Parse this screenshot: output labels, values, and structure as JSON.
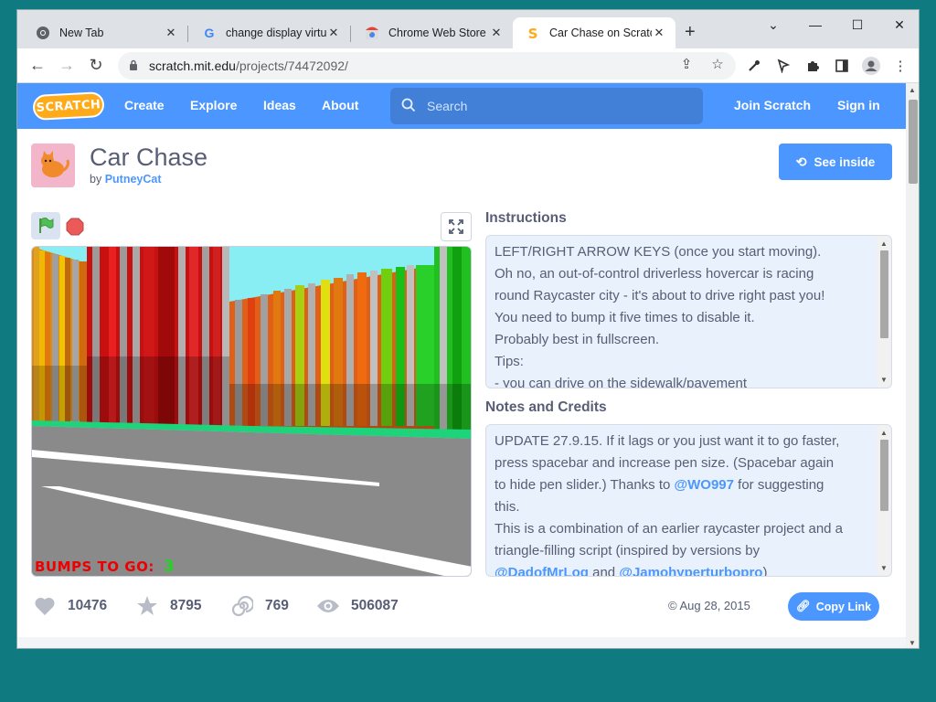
{
  "browser": {
    "tabs": [
      {
        "title": "New Tab",
        "favicon": "chrome-icon"
      },
      {
        "title": "change display virtua",
        "favicon": "google-icon"
      },
      {
        "title": "Chrome Web Store -",
        "favicon": "chrome-web-store-icon"
      },
      {
        "title": "Car Chase on Scratch",
        "favicon": "scratch-icon",
        "active": true
      }
    ],
    "url_host": "scratch.mit.edu",
    "url_path": "/projects/74472092/"
  },
  "scratch": {
    "logo_text": "SCRATCH",
    "nav": [
      "Create",
      "Explore",
      "Ideas",
      "About"
    ],
    "search_placeholder": "Search",
    "join": "Join Scratch",
    "signin": "Sign in"
  },
  "project": {
    "title": "Car Chase",
    "by_label": "by",
    "author": "PutneyCat",
    "see_inside": "See inside",
    "stage_hud_label": "BUMPS TO GO:",
    "stage_hud_value": "3",
    "instructions_heading": "Instructions",
    "instructions_lines": [
      "LEFT/RIGHT ARROW KEYS (once you start moving).",
      "Oh no, an out-of-control driverless hovercar is racing",
      "round Raycaster city - it's about to drive right past you!",
      "You need to bump it five times to disable it.",
      "Probably best in fullscreen.",
      "Tips:",
      "- you can drive on the sidewalk/pavement"
    ],
    "notes_heading": "Notes and Credits",
    "notes": {
      "l1": "UPDATE 27.9.15. If it lags or you just want it to go faster,",
      "l2": "press spacebar and increase pen size. (Spacebar again",
      "l3a": "to hide pen slider.) Thanks to ",
      "l3_link": "@WO997",
      "l3b": " for suggesting",
      "l4": "this.",
      "l5": "This is a combination of an earlier raycaster project and a",
      "l6": "triangle-filling script (inspired by versions by",
      "l7_link1": "@DadofMrLog",
      "l7_mid": " and ",
      "l7_link2": "@Jamohyperturbopro",
      "l7_end": ")"
    },
    "stats": {
      "loves": "10476",
      "favorites": "8795",
      "remixes": "769",
      "views": "506087"
    },
    "date": "Aug 28, 2015",
    "copy_link": "Copy Link"
  },
  "colors": {
    "scratch_blue": "#4c97ff",
    "desktop": "#0f7a80",
    "text": "#575e75"
  }
}
